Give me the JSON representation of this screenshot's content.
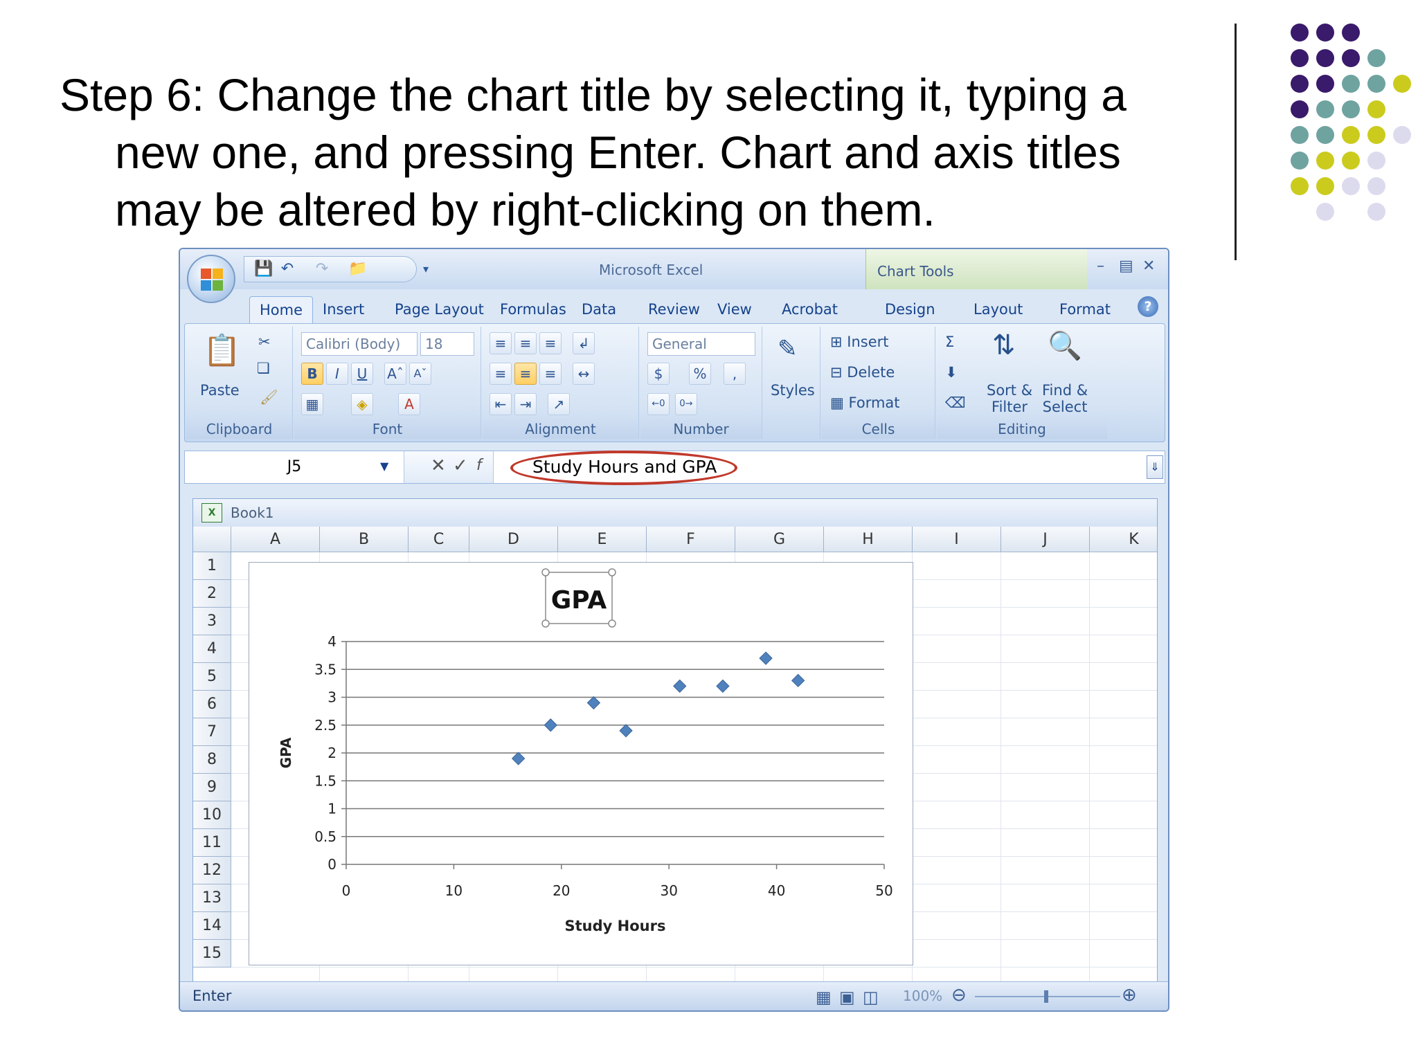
{
  "slide": {
    "heading_lines": [
      "Step 6: Change the chart title by selecting it, typing a",
      "new one, and pressing Enter. Chart and axis titles",
      "may be altered by right-clicking on them."
    ],
    "dot_colors": {
      "purple": "#3a1a6b",
      "teal": "#6fa3a0",
      "yellow": "#cbcb1e",
      "lavender": "#dcdbee"
    }
  },
  "excel": {
    "app_title": "Microsoft Excel",
    "context_tab": "Chart Tools",
    "tabs": [
      "Home",
      "Insert",
      "Page Layout",
      "Formulas",
      "Data",
      "Review",
      "View",
      "Acrobat",
      "Design",
      "Layout",
      "Format"
    ],
    "active_tab": "Home",
    "ribbon": {
      "clipboard": {
        "paste": "Paste",
        "label": "Clipboard"
      },
      "font": {
        "name": "Calibri (Body)",
        "size": "18",
        "bold": "B",
        "italic": "I",
        "underline": "U",
        "label": "Font"
      },
      "alignment": {
        "label": "Alignment"
      },
      "number": {
        "format": "General",
        "currency": "$",
        "percent": "%",
        "comma": ",",
        "label": "Number"
      },
      "styles": {
        "label": "Styles"
      },
      "cells": {
        "insert": "Insert",
        "delete": "Delete",
        "format": "Format",
        "label": "Cells"
      },
      "editing": {
        "sort_line1": "Sort &",
        "sort_line2": "Filter",
        "find_line1": "Find &",
        "find_line2": "Select",
        "label": "Editing"
      }
    },
    "formula_bar": {
      "name_box": "J5",
      "value": "Study Hours and GPA"
    },
    "workbook_title": "Book1",
    "columns": [
      "A",
      "B",
      "C",
      "D",
      "E",
      "F",
      "G",
      "H",
      "I",
      "J",
      "K"
    ],
    "rows": [
      "1",
      "2",
      "3",
      "4",
      "5",
      "6",
      "7",
      "8",
      "9",
      "10",
      "11",
      "12",
      "13",
      "14",
      "15"
    ],
    "status": "Enter",
    "zoom": "100%"
  },
  "chart_data": {
    "type": "scatter",
    "title": "GPA",
    "xlabel": "Study Hours",
    "ylabel": "GPA",
    "xlim": [
      0,
      50
    ],
    "ylim": [
      0,
      4
    ],
    "x_ticks": [
      "0",
      "10",
      "20",
      "30",
      "40",
      "50"
    ],
    "y_ticks": [
      "0",
      "0.5",
      "1",
      "1.5",
      "2",
      "2.5",
      "3",
      "3.5",
      "4"
    ],
    "grid": true,
    "legend": "none",
    "marker_color": "#4f81bd",
    "x": [
      16,
      19,
      23,
      26,
      31,
      35,
      39,
      42
    ],
    "y": [
      1.9,
      2.5,
      2.9,
      2.4,
      3.2,
      3.2,
      3.7,
      3.3
    ]
  }
}
